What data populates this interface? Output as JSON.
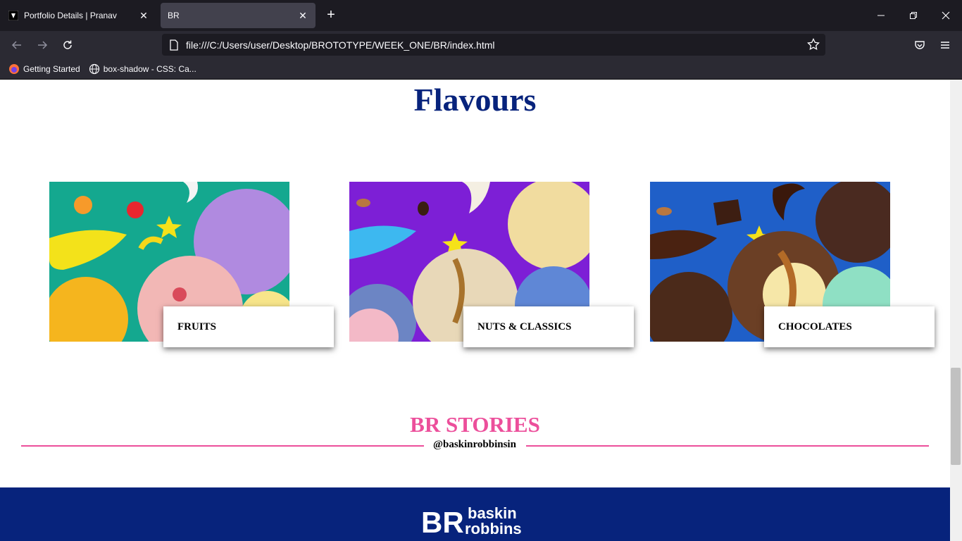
{
  "browser": {
    "tabs": [
      {
        "title": "Portfolio Details | Pranav",
        "active": false
      },
      {
        "title": "BR",
        "active": true
      }
    ],
    "url": "file:///C:/Users/user/Desktop/BROTOTYPE/WEEK_ONE/BR/index.html",
    "bookmarks": [
      {
        "label": "Getting Started",
        "icon": "firefox-icon"
      },
      {
        "label": "box-shadow - CSS: Ca...",
        "icon": "globe-icon"
      }
    ]
  },
  "page": {
    "heading": "Flavours",
    "cards": [
      {
        "label": "FRUITS",
        "bg": "#14a88f",
        "scoop_colors": [
          "#b08ae0",
          "#f5b51e",
          "#f2b7b5"
        ]
      },
      {
        "label": "NUTS & CLASSICS",
        "bg": "#7d1fd6",
        "scoop_colors": [
          "#f1dc9f",
          "#e8d8b8",
          "#5f87d6"
        ]
      },
      {
        "label": "CHOCOLATES",
        "bg": "#1f5fc8",
        "scoop_colors": [
          "#4a2a20",
          "#6b3f25",
          "#8fe0c4"
        ]
      }
    ],
    "stories_title": "BR STORIES",
    "stories_handle": "@baskinrobbinsin",
    "footer_logo_text": [
      "BR",
      "baskin",
      "robbins"
    ]
  },
  "colors": {
    "heading": "#07237c",
    "accent_pink": "#ec4f9b",
    "footer_bg": "#07237c"
  }
}
